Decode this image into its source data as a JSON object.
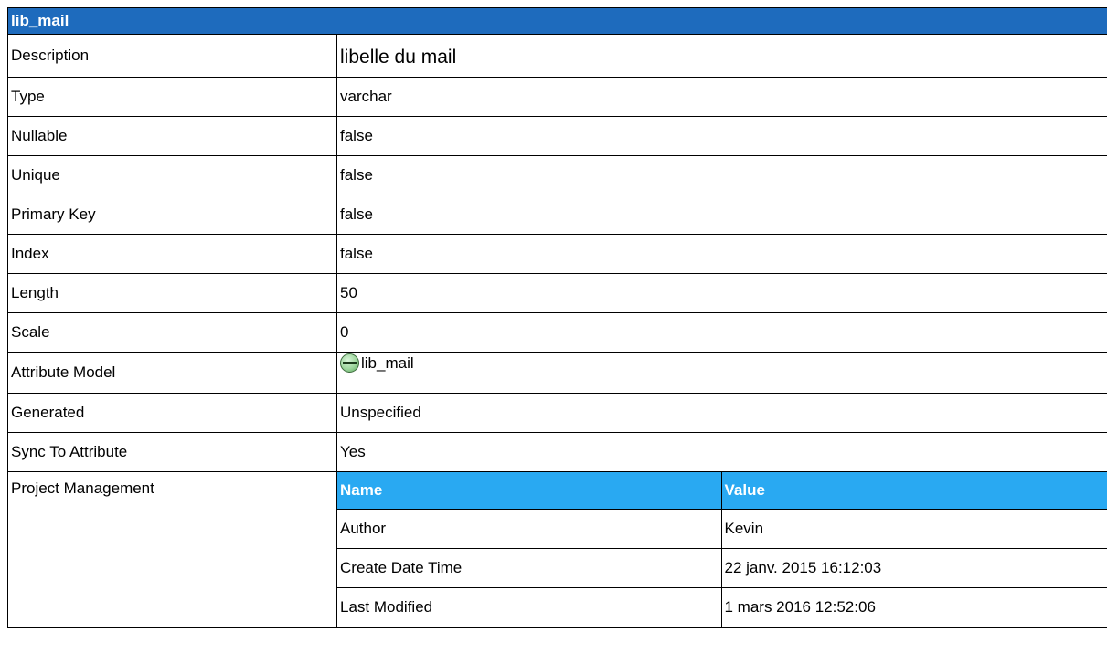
{
  "title": "lib_mail",
  "rows": [
    {
      "label": "Description",
      "value": "libelle du mail"
    },
    {
      "label": "Type",
      "value": "varchar"
    },
    {
      "label": "Nullable",
      "value": "false"
    },
    {
      "label": "Unique",
      "value": "false"
    },
    {
      "label": "Primary Key",
      "value": "false"
    },
    {
      "label": "Index",
      "value": "false"
    },
    {
      "label": "Length",
      "value": "50"
    },
    {
      "label": "Scale",
      "value": "0"
    },
    {
      "label": "Attribute Model",
      "value": "lib_mail",
      "icon": "attribute-model-icon"
    },
    {
      "label": "Generated",
      "value": "Unspecified"
    },
    {
      "label": "Sync To Attribute",
      "value": "Yes"
    }
  ],
  "project_management": {
    "label": "Project Management",
    "headers": [
      "Name",
      "Value"
    ],
    "rows": [
      {
        "name": "Author",
        "value": "Kevin"
      },
      {
        "name": "Create Date Time",
        "value": "22 janv. 2015 16:12:03"
      },
      {
        "name": "Last Modified",
        "value": "1 mars 2016 12:52:06"
      }
    ]
  },
  "colors": {
    "header_bg": "#1e6bbd",
    "subheader_bg": "#29a9f2",
    "header_text": "#ffffff"
  }
}
